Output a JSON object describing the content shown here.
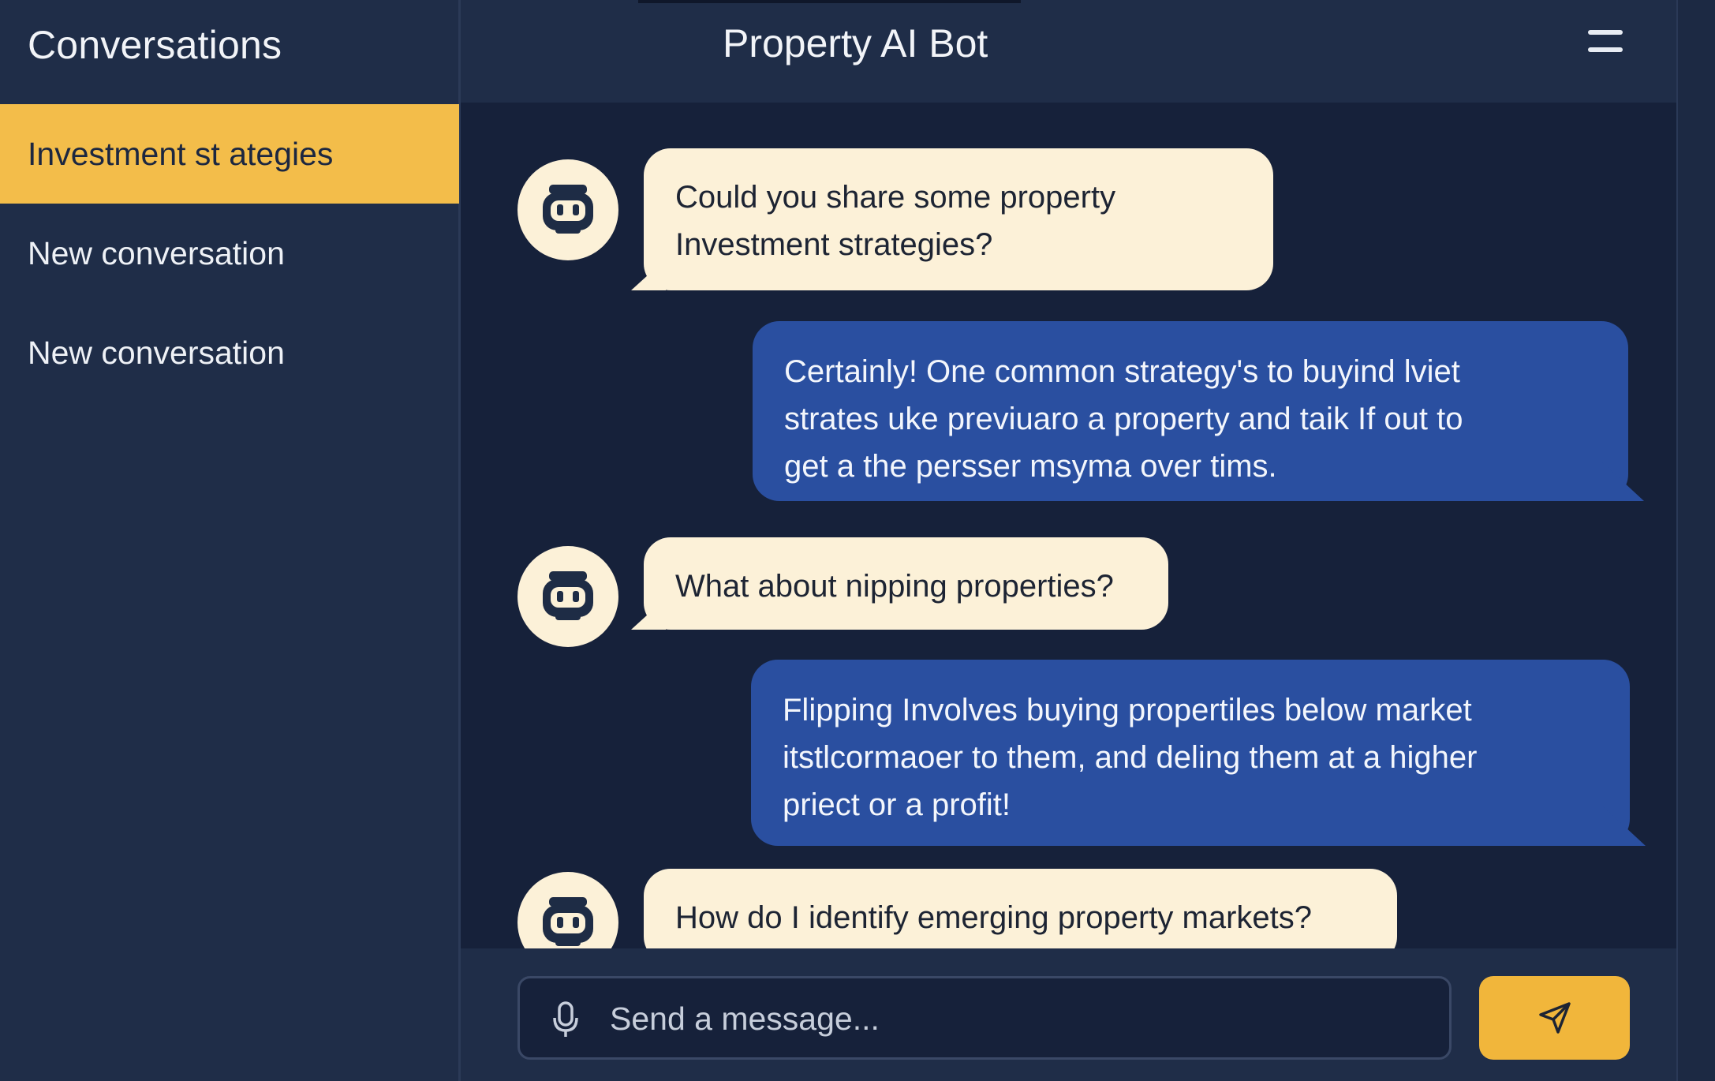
{
  "sidebar": {
    "title": "Conversations",
    "items": [
      {
        "label": "Investment st ategies",
        "active": true
      },
      {
        "label": "New conversation",
        "active": false
      },
      {
        "label": "New conversation",
        "active": false
      }
    ]
  },
  "header": {
    "title": "Property AI Bot",
    "menu_icon": "hamburger-menu-icon"
  },
  "messages": [
    {
      "role": "bot",
      "avatar_icon": "robot-avatar-icon",
      "text": "Could you share some property\nInvestment strategies?"
    },
    {
      "role": "user",
      "text": "Certainly! One common strategy's to buyind lviet\nstrates uke previuaro a property and taik If out to\nget a the persser msyma over tims."
    },
    {
      "role": "bot",
      "avatar_icon": "robot-avatar-icon",
      "text": "What about nipping properties?"
    },
    {
      "role": "user",
      "text": "Flipping Involves buying propertiles below market\nitstlcormaoer to them, and deling them at a higher\npriect or a profit!"
    },
    {
      "role": "bot",
      "avatar_icon": "robot-avatar-icon",
      "text": "How do I identify emerging property markets?"
    }
  ],
  "composer": {
    "placeholder": "Send a message...",
    "mic_icon": "microphone-icon",
    "send_icon": "send-arrow-icon"
  },
  "colors": {
    "sidebar_bg": "#1f2d48",
    "main_bg": "#16213a",
    "accent": "#f3bd4a",
    "bot_bubble": "#fcf1d8",
    "user_bubble": "#2a4fa0"
  }
}
